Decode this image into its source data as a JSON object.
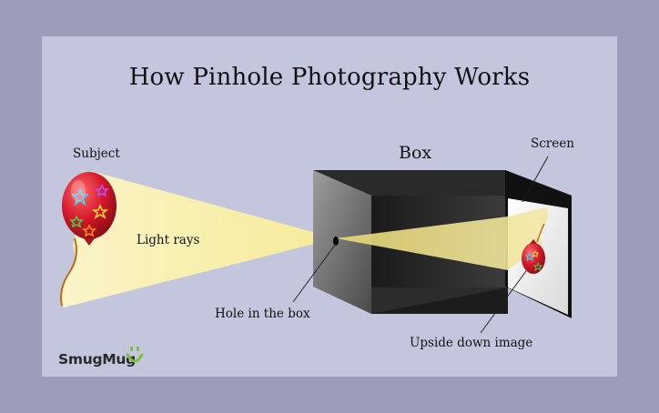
{
  "title": "How Pinhole Photography Works",
  "labels": {
    "subject": "Subject",
    "light_rays": "Light rays",
    "box": "Box",
    "screen": "Screen",
    "hole": "Hole in the box",
    "upside_down": "Upside down image"
  },
  "brand": {
    "name": "SmugMug",
    "logo_icon": "smiley-face-icon"
  },
  "colors": {
    "outer_background": "#9a9cb9",
    "panel_background": "#c4c6dd",
    "light_beam": "#fdf7c0",
    "balloon": "#d6202a",
    "brand_green": "#7ac143"
  }
}
